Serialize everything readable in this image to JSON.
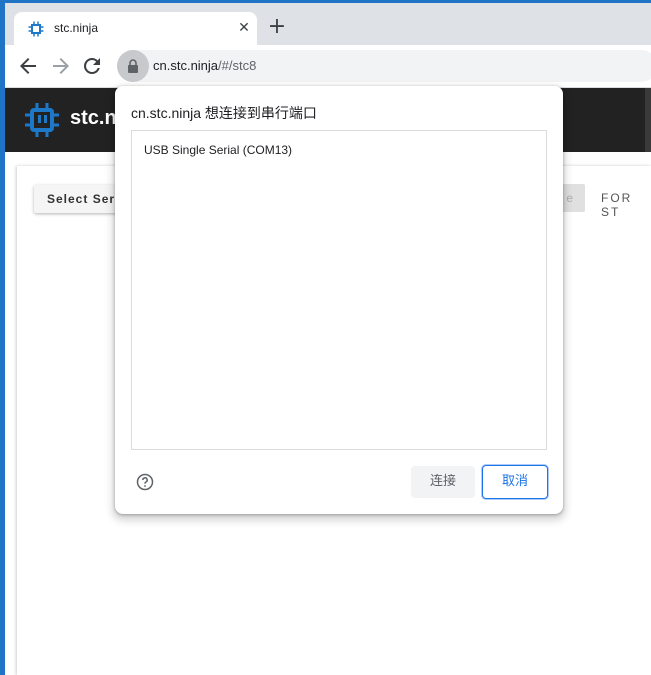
{
  "tab": {
    "title": "stc.ninja",
    "close_glyph": "✕",
    "favicon_icon": "chip-icon"
  },
  "new_tab_glyph": "+",
  "omnibox": {
    "host": "cn.stc.ninja",
    "path": "/#/stc8"
  },
  "site": {
    "name": "stc.ni"
  },
  "page": {
    "select_serial_label": "Select Seri",
    "disabled_button_label": "e",
    "for_label": "FOR ST"
  },
  "dialog": {
    "title": "cn.stc.ninja 想连接到串行端口",
    "ports": [
      "USB Single Serial (COM13)"
    ],
    "connect_label": "连接",
    "cancel_label": "取消"
  },
  "colors": {
    "accent": "#1a73e8",
    "header_bg": "#222222",
    "favicon": "#1e78c8"
  }
}
